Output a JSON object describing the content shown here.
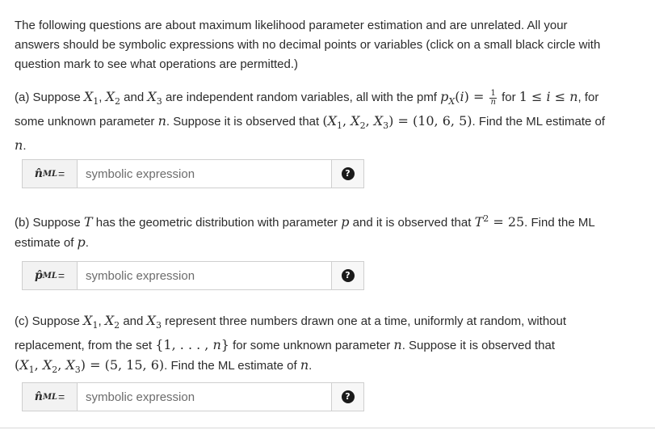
{
  "intro": {
    "line1": "The following questions are about maximum likelihood parameter estimation and are unrelated. All your",
    "line2": "answers should be symbolic expressions with no decimal points or variables (click on a small black circle with",
    "line3": "question mark to see what operations are permitted.)"
  },
  "part_a": {
    "t1": "(a) Suppose ",
    "t2": " and ",
    "t3": " are independent random variables, all with the pmf ",
    "t4": " for ",
    "t5": ", for",
    "t6": "some unknown parameter ",
    "t7": ". Suppose it is observed that ",
    "t8": ". Find the ML estimate of",
    "input_placeholder": "symbolic expression",
    "help_glyph": "?"
  },
  "part_b": {
    "t1": "(b) Suppose ",
    "t2": " has the geometric distribution with parameter ",
    "t3": " and it is observed that ",
    "t4": ". Find the ML",
    "t5": "estimate of ",
    "input_placeholder": "symbolic expression",
    "help_glyph": "?"
  },
  "part_c": {
    "t1": "(c) Suppose ",
    "t2": " and ",
    "t3": " represent three numbers drawn one at a time, uniformly at random, without",
    "t4": "replacement, from the set ",
    "t5": " for some unknown parameter ",
    "t6": ". Suppose it is observed that",
    "t7": ". Find the ML estimate of ",
    "input_placeholder": "symbolic expression",
    "help_glyph": "?"
  },
  "colors": {
    "text": "#2b2b2b",
    "addon_bg": "#f2f2f2",
    "border": "#cfcfcf",
    "help_icon": "#1a1a1a"
  }
}
